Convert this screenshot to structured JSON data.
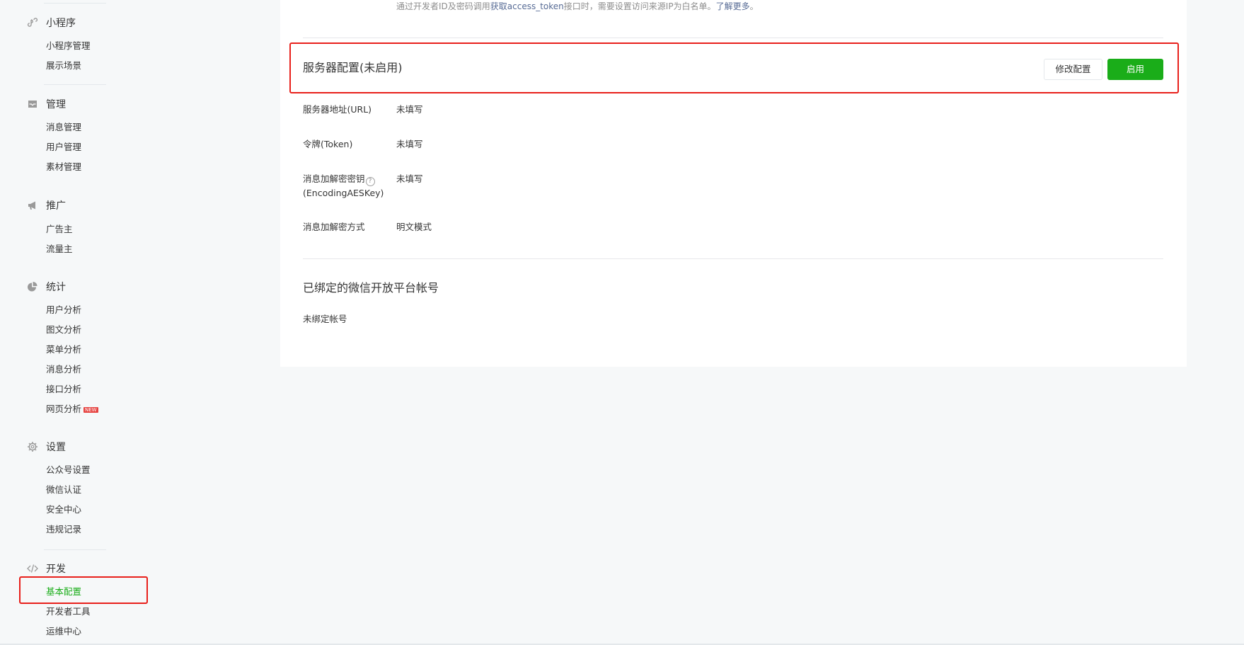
{
  "sidebar": {
    "groups": [
      {
        "title": "小程序",
        "icon": "mini-program-icon",
        "items": [
          {
            "label": "小程序管理"
          },
          {
            "label": "展示场景"
          }
        ]
      },
      {
        "title": "管理",
        "icon": "inbox-icon",
        "items": [
          {
            "label": "消息管理"
          },
          {
            "label": "用户管理"
          },
          {
            "label": "素材管理"
          }
        ]
      },
      {
        "title": "推广",
        "icon": "megaphone-icon",
        "items": [
          {
            "label": "广告主"
          },
          {
            "label": "流量主"
          }
        ]
      },
      {
        "title": "统计",
        "icon": "pie-chart-icon",
        "items": [
          {
            "label": "用户分析"
          },
          {
            "label": "图文分析"
          },
          {
            "label": "菜单分析"
          },
          {
            "label": "消息分析"
          },
          {
            "label": "接口分析"
          },
          {
            "label": "网页分析",
            "badge": "NEW"
          }
        ]
      },
      {
        "title": "设置",
        "icon": "gear-icon",
        "items": [
          {
            "label": "公众号设置"
          },
          {
            "label": "微信认证"
          },
          {
            "label": "安全中心"
          },
          {
            "label": "违规记录"
          }
        ]
      },
      {
        "title": "开发",
        "icon": "code-icon",
        "items": [
          {
            "label": "基本配置",
            "active": true
          },
          {
            "label": "开发者工具"
          },
          {
            "label": "运维中心"
          }
        ]
      }
    ]
  },
  "main": {
    "top_note": {
      "before": "通过开发者ID及密码调用",
      "link1": "获取access_token",
      "middle": "接口时，需要设置访问来源IP为白名单。",
      "link2": "了解更多",
      "after": "。"
    },
    "server_config": {
      "title": "服务器配置(未启用)",
      "modify_button": "修改配置",
      "enable_button": "启用",
      "rows": [
        {
          "label": "服务器地址(URL)",
          "value": "未填写"
        },
        {
          "label": "令牌(Token)",
          "value": "未填写"
        },
        {
          "label": "消息加解密密钥",
          "label2": "(EncodingAESKey)",
          "help": "?",
          "value": "未填写"
        },
        {
          "label": "消息加解密方式",
          "value": "明文模式"
        }
      ]
    },
    "bound_platform": {
      "title": "已绑定的微信开放平台帐号",
      "status": "未绑定帐号"
    }
  },
  "colors": {
    "accent_green": "#1aad19",
    "link_blue": "#576b95",
    "highlight_red": "#e8201b",
    "badge_red": "#e64340"
  }
}
